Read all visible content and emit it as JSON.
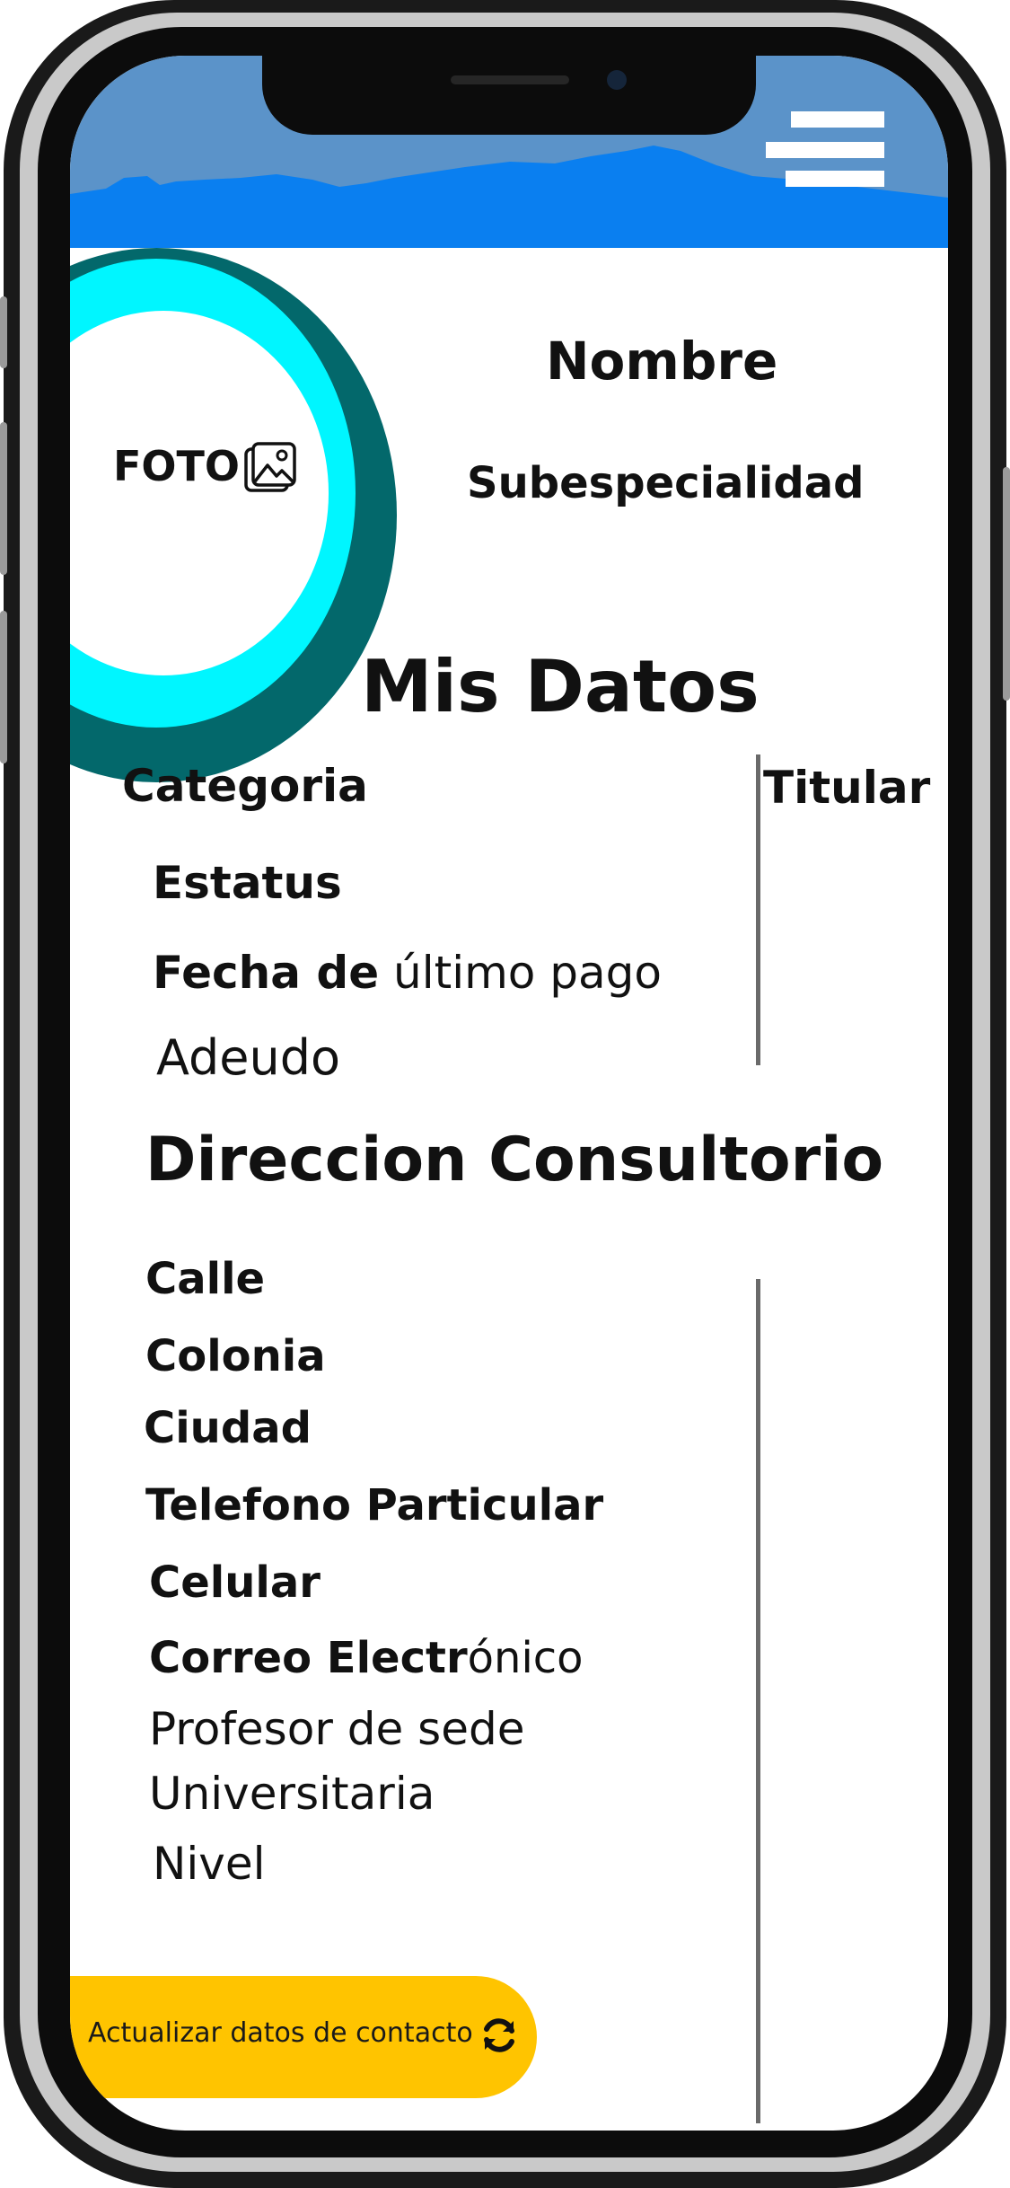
{
  "profile": {
    "photo_label": "FOTO",
    "photo_icon": "image-icon",
    "name": "Nombre",
    "subspecialty": "Subespecialidad"
  },
  "my_data": {
    "heading": "Mis Datos",
    "category": "Categoria",
    "holder": "Titular",
    "status": "Estatus",
    "last_payment_bold": "Fecha de",
    "last_payment_rest": " último pago",
    "debt": "Adeudo"
  },
  "office": {
    "heading": "Direccion Consultorio",
    "street": "Calle",
    "neighborhood": "Colonia",
    "city": "Ciudad",
    "home_phone": "Telefono Particular",
    "mobile": "Celular",
    "email_bold": "Correo Electr",
    "email_rest": "ónico",
    "professor_line1": "Profesor de sede",
    "professor_line2": "Universitaria",
    "level": "Nivel"
  },
  "actions": {
    "update_contact_label": "Actualizar datos de contacto",
    "update_contact_icon": "refresh-icon",
    "menu_icon": "hamburger-menu-icon"
  },
  "colors": {
    "header_sky": "#5b93c9",
    "header_mountains": "#0a7ff0",
    "ring_dark": "#03686b",
    "ring_cyan": "#00f6ff",
    "cta_yellow": "#ffc400"
  }
}
